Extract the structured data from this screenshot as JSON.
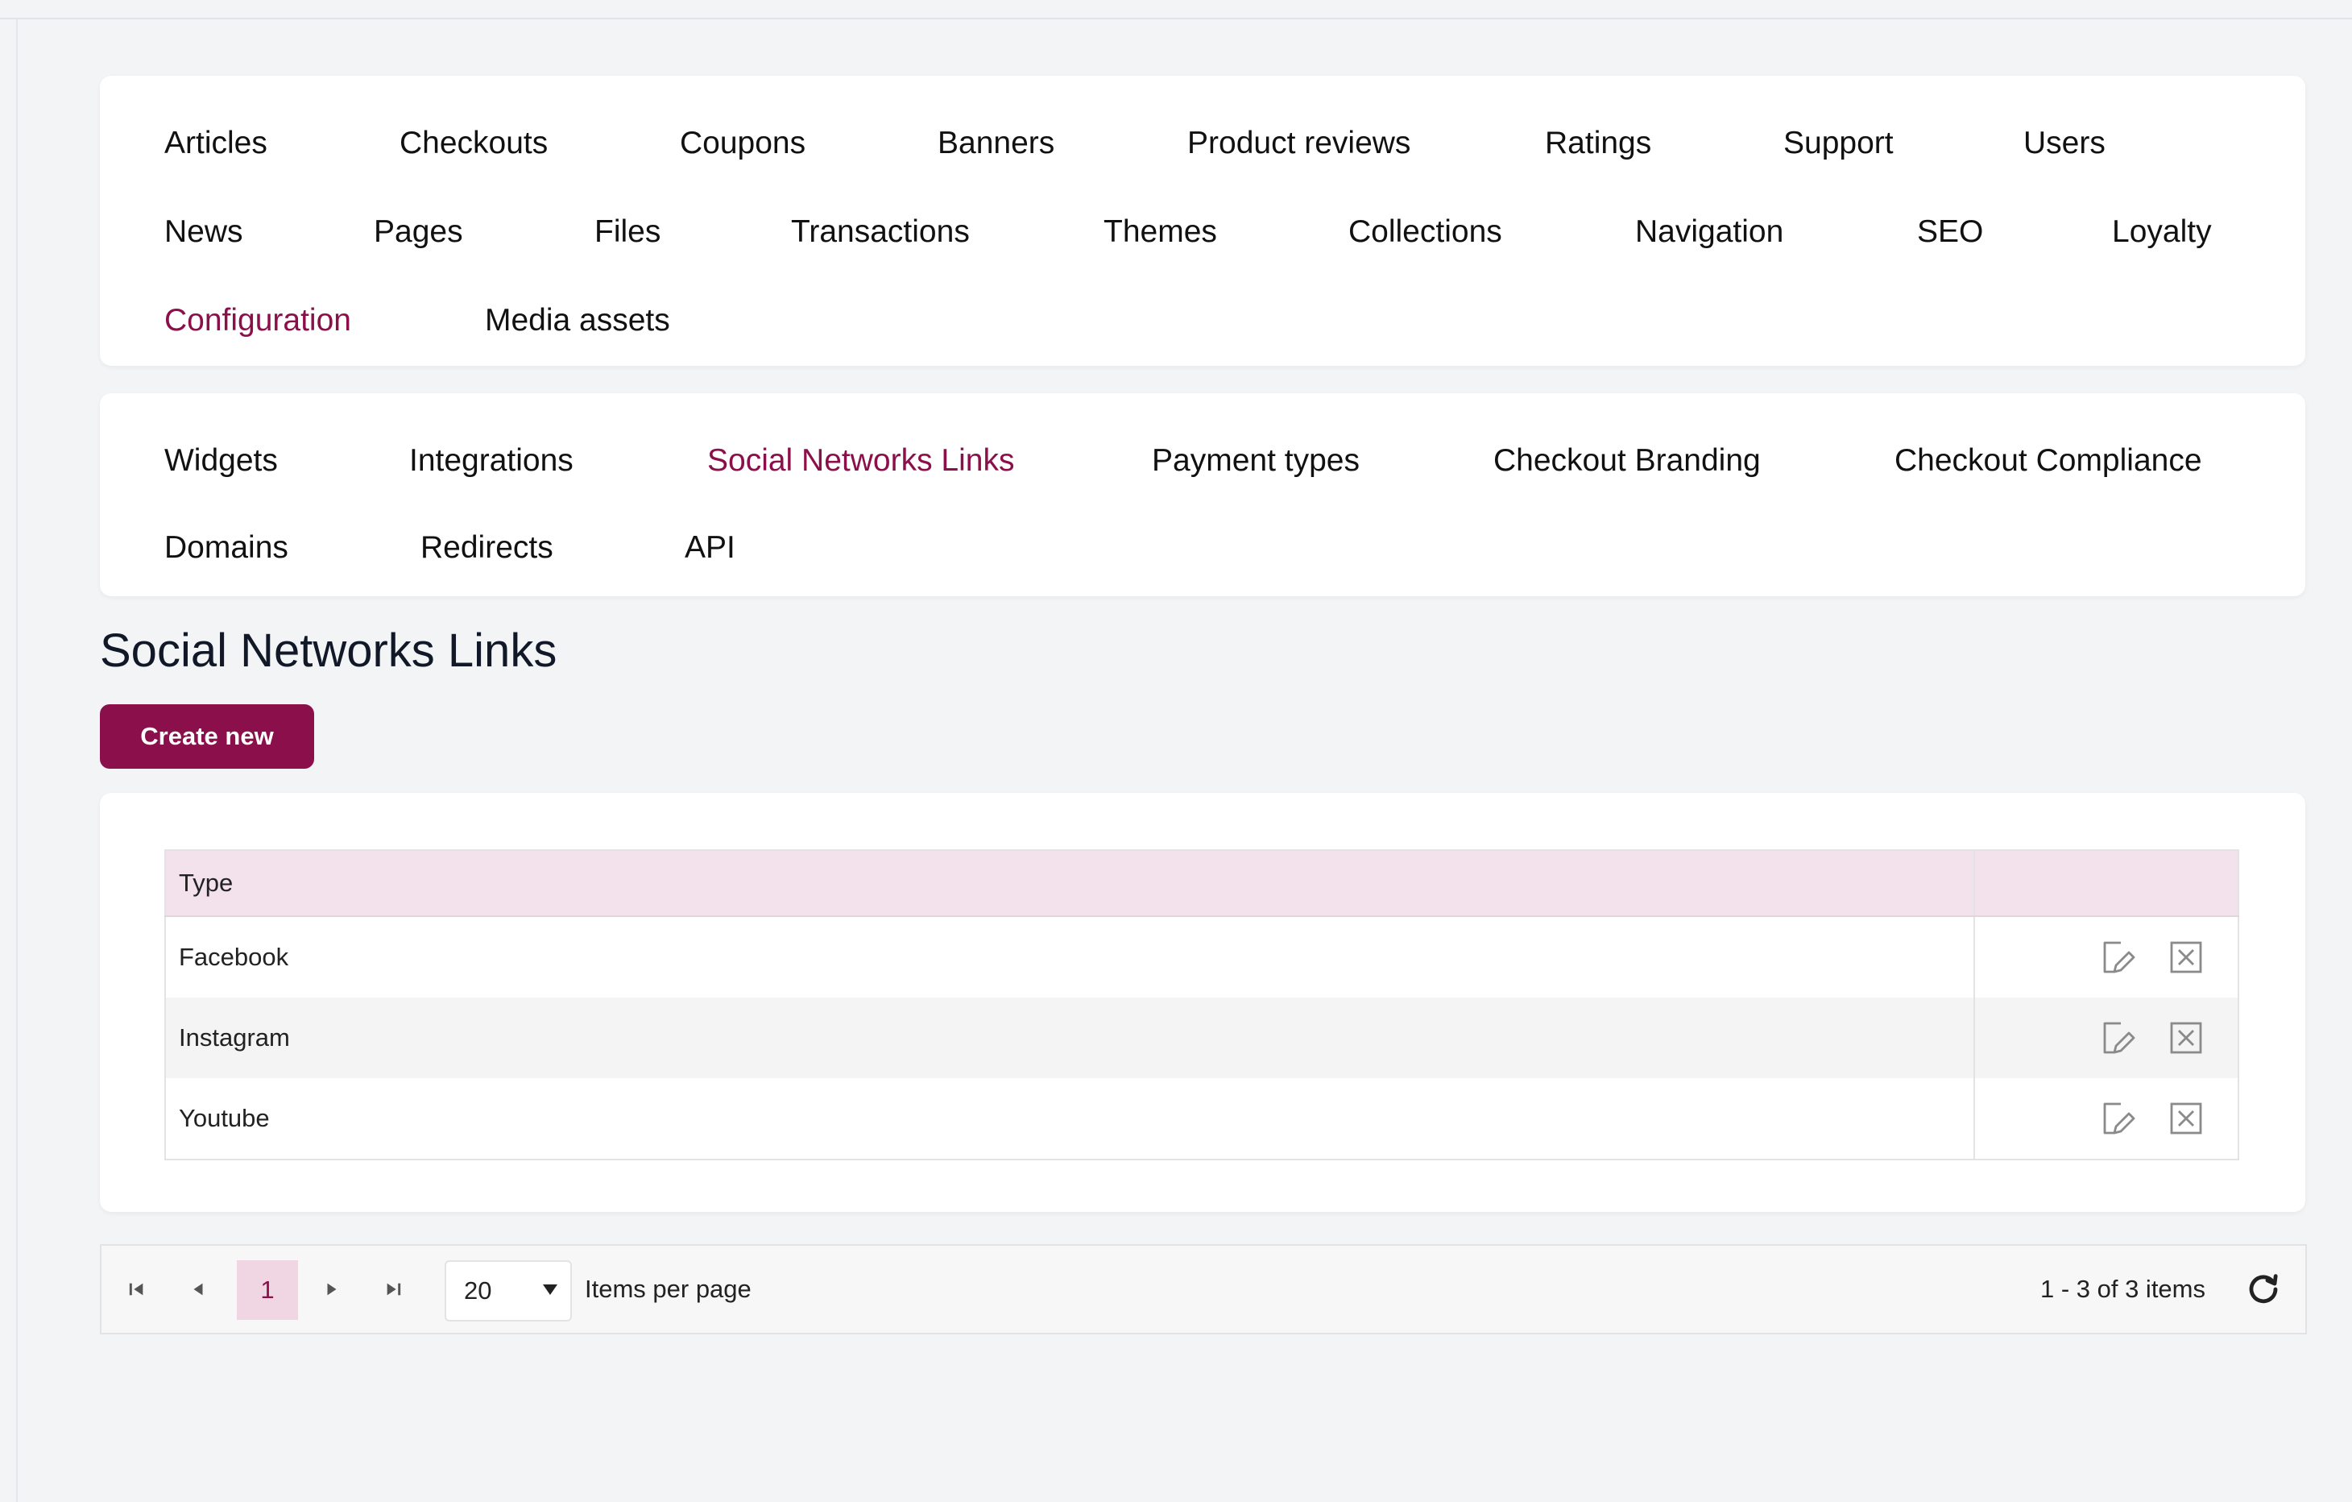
{
  "primary_nav": [
    {
      "label": "Articles"
    },
    {
      "label": "Checkouts"
    },
    {
      "label": "Coupons"
    },
    {
      "label": "Banners"
    },
    {
      "label": "Product reviews"
    },
    {
      "label": "Ratings"
    },
    {
      "label": "Support"
    },
    {
      "label": "Users"
    },
    {
      "label": "News"
    },
    {
      "label": "Pages"
    },
    {
      "label": "Files"
    },
    {
      "label": "Transactions"
    },
    {
      "label": "Themes"
    },
    {
      "label": "Collections"
    },
    {
      "label": "Navigation"
    },
    {
      "label": "SEO"
    },
    {
      "label": "Loyalty"
    },
    {
      "label": "Configuration",
      "active": true
    },
    {
      "label": "Media assets"
    }
  ],
  "secondary_nav": [
    {
      "label": "Widgets"
    },
    {
      "label": "Integrations"
    },
    {
      "label": "Social Networks Links",
      "active": true
    },
    {
      "label": "Payment types"
    },
    {
      "label": "Checkout Branding"
    },
    {
      "label": "Checkout Compliance"
    },
    {
      "label": "Domains"
    },
    {
      "label": "Redirects"
    },
    {
      "label": "API"
    }
  ],
  "page": {
    "title": "Social Networks Links",
    "create_label": "Create new"
  },
  "table": {
    "columns": [
      "Type",
      ""
    ],
    "rows": [
      {
        "type": "Facebook",
        "actions": [
          "edit-icon",
          "delete-icon"
        ]
      },
      {
        "type": "Instagram",
        "actions": [
          "edit-icon",
          "delete-icon"
        ]
      },
      {
        "type": "Youtube",
        "actions": [
          "edit-icon",
          "delete-icon"
        ]
      }
    ]
  },
  "pager": {
    "current_page": "1",
    "page_size": "20",
    "page_size_label": "Items per page",
    "info": "1 - 3 of 3 items"
  },
  "colors": {
    "accent": "#8b0f4a",
    "header_bg": "#f3e2ec",
    "page_bg": "#f3f4f6"
  }
}
